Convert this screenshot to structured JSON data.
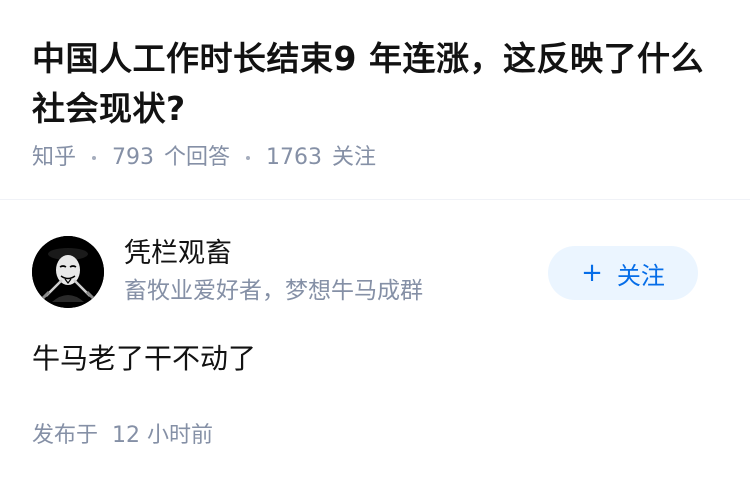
{
  "question": {
    "title": "中国人工作时长结束9 年连涨，这反映了什么社会现状?",
    "meta": {
      "source": "知乎",
      "answers_count": "793",
      "answers_label": "个回答",
      "followers_count": "1763",
      "followers_label": "关注"
    }
  },
  "author": {
    "name": "凭栏观畜",
    "bio": "畜牧业爱好者，梦想牛马成群",
    "avatar_icon": "masked-face-avatar",
    "follow_label": "关注",
    "follow_icon": "plus-icon"
  },
  "answer": {
    "content": "牛马老了干不动了",
    "time_prefix": "发布于",
    "time_value": "12 小时前"
  },
  "colors": {
    "meta_gray": "#8590a6",
    "follow_blue": "#056de8",
    "follow_bg": "#ebf5ff"
  }
}
